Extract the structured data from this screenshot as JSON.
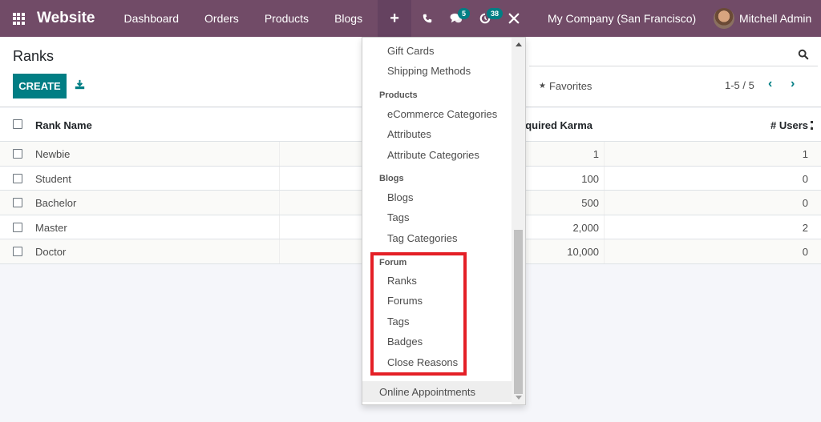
{
  "navbar": {
    "app_name": "Website",
    "menu": [
      "Dashboard",
      "Orders",
      "Products",
      "Blogs"
    ],
    "plus_label": "+",
    "systray": {
      "phone_icon": "phone-icon",
      "messages_icon": "chat-icon",
      "messages_count": "5",
      "activity_icon": "clock-icon",
      "activity_count": "38",
      "debug_icon": "tools-icon"
    },
    "company": "My Company (San Francisco)",
    "user": "Mitchell Admin"
  },
  "control_panel": {
    "title": "Ranks",
    "create_label": "CREATE",
    "favorites_label": "Favorites",
    "pager": "1-5 / 5"
  },
  "table": {
    "columns": [
      "Rank Name",
      "Required Karma",
      "# Users"
    ],
    "rows": [
      {
        "name": "Newbie",
        "karma": "1",
        "users": "1"
      },
      {
        "name": "Student",
        "karma": "100",
        "users": "0"
      },
      {
        "name": "Bachelor",
        "karma": "500",
        "users": "0"
      },
      {
        "name": "Master",
        "karma": "2,000",
        "users": "2"
      },
      {
        "name": "Doctor",
        "karma": "10,000",
        "users": "0"
      }
    ]
  },
  "dropdown": {
    "items_top": [
      "Gift Cards",
      "Shipping Methods"
    ],
    "sections": [
      {
        "header": "Products",
        "items": [
          "eCommerce Categories",
          "Attributes",
          "Attribute Categories"
        ]
      },
      {
        "header": "Blogs",
        "items": [
          "Blogs",
          "Tags",
          "Tag Categories"
        ]
      },
      {
        "header": "Forum",
        "items": [
          "Ranks",
          "Forums",
          "Tags",
          "Badges",
          "Close Reasons"
        ]
      }
    ],
    "bottom_item": "Online Appointments"
  },
  "colors": {
    "navbar": "#714b67",
    "primary": "#017e84",
    "highlight": "#e41f26"
  }
}
